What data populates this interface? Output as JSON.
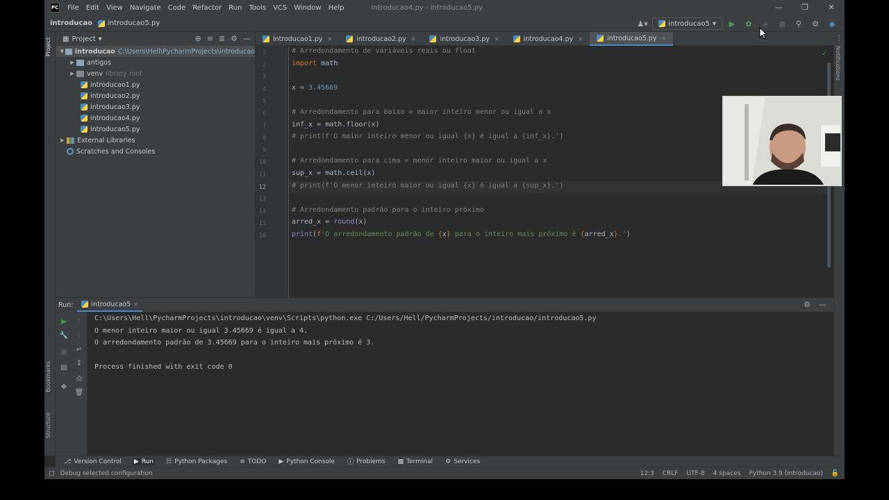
{
  "app": {
    "window_title": "introducao4.py - introducao5.py",
    "logo": "PC"
  },
  "menu": [
    "File",
    "Edit",
    "View",
    "Navigate",
    "Code",
    "Refactor",
    "Run",
    "Tools",
    "VCS",
    "Window",
    "Help"
  ],
  "breadcrumb": {
    "project": "introducao",
    "file": "introducao5.py"
  },
  "run_config": {
    "name": "introducao5"
  },
  "project_panel": {
    "title": "Project",
    "root": {
      "name": "introducao",
      "path": "C:\\Users\\Hell\\PycharmProjects\\introducao"
    },
    "items": [
      {
        "name": "antigos",
        "kind": "folder",
        "note": ""
      },
      {
        "name": "venv",
        "kind": "folder",
        "note": "library root"
      },
      {
        "name": "introducao1.py",
        "kind": "py",
        "note": ""
      },
      {
        "name": "introducao2.py",
        "kind": "py",
        "note": ""
      },
      {
        "name": "introducao3.py",
        "kind": "py",
        "note": ""
      },
      {
        "name": "introducao4.py",
        "kind": "py",
        "note": ""
      },
      {
        "name": "introducao5.py",
        "kind": "py",
        "note": ""
      }
    ],
    "external": "External Libraries",
    "scratches": "Scratches and Consoles"
  },
  "tabs": [
    {
      "label": "introducao1.py",
      "active": false
    },
    {
      "label": "introducao2.py",
      "active": false
    },
    {
      "label": "introducao3.py",
      "active": false
    },
    {
      "label": "introducao4.py",
      "active": false
    },
    {
      "label": "introducao5.py",
      "active": true
    }
  ],
  "editor": {
    "current_line": 12,
    "lines": [
      "# Arredondamento de variáveis reais ou float",
      "import math",
      "",
      "x = 3.45669",
      "",
      "# Arredondamento para baixo = maior inteiro menor ou igual a x",
      "inf_x = math.floor(x)",
      "# print(f'O maior inteiro menor ou igual {x} é igual a {inf_x}.')",
      "",
      "# Arredondamento para cima = menor inteiro maior ou igual a x",
      "sup_x = math.ceil(x)",
      "# print(f'O menor inteiro maior ou igual {x} é igual a {sup_x}.')",
      "",
      "# Arredondamento padrão para o inteiro próximo",
      "arred_x = round(x)",
      "print(f'O arredondamento padrão de {x} para o inteiro mais próximo é {arred_x}.')"
    ]
  },
  "run_panel": {
    "label": "Run:",
    "tab": "introducao5",
    "output": [
      "C:\\Users\\Hell\\PycharmProjects\\introducao\\venv\\Scripts\\python.exe C:/Users/Hell/PycharmProjects/introducao/introducao5.py",
      "O menor inteiro maior ou igual 3.45669 é igual a 4.",
      "O arredondamento padrão de 3.45669 para o inteiro mais próximo é 3.",
      "",
      "Process finished with exit code 0"
    ]
  },
  "tool_windows": [
    "Version Control",
    "Run",
    "Python Packages",
    "TODO",
    "Python Console",
    "Problems",
    "Terminal",
    "Services"
  ],
  "side_labels": {
    "project": "Project",
    "bookmarks": "Bookmarks",
    "structure": "Structure",
    "notifications": "Notifications"
  },
  "status": {
    "message": "Debug selected configuration",
    "position": "12:3",
    "line_sep": "CRLF",
    "encoding": "UTF-8",
    "indent": "4 spaces",
    "interpreter": "Python 3.9 (introducao)"
  }
}
